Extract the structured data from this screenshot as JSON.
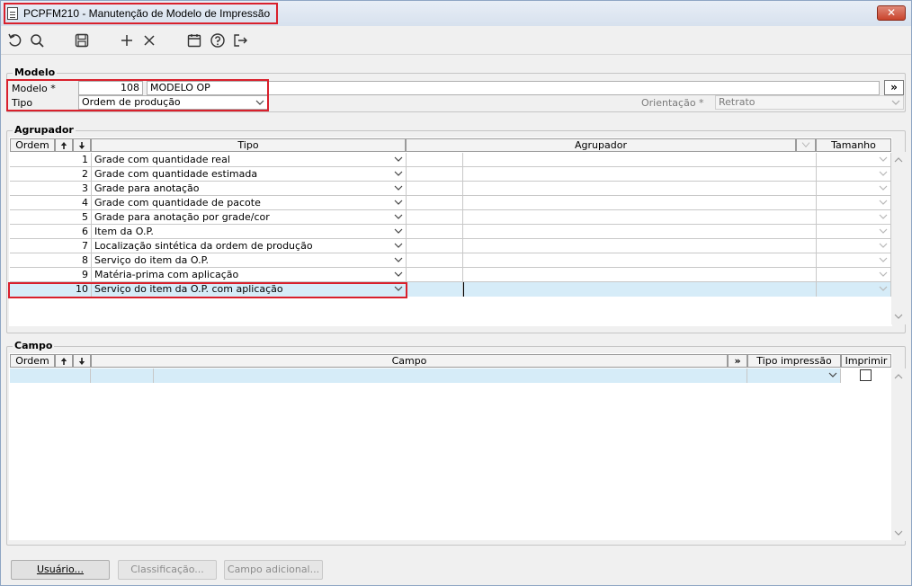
{
  "window": {
    "title": "PCPFM210 - Manutenção de Modelo de Impressão"
  },
  "toolbar": {
    "icons": [
      "undo-icon",
      "search-icon",
      "save-icon",
      "add-icon",
      "delete-icon",
      "calendar-icon",
      "help-icon",
      "exit-icon"
    ]
  },
  "modelo": {
    "group_label": "Modelo",
    "modelo_label": "Modelo *",
    "modelo_code": "108",
    "modelo_name": "MODELO OP",
    "tipo_label": "Tipo",
    "tipo_value": "Ordem de produção",
    "orientacao_label": "Orientação *",
    "orientacao_value": "Retrato",
    "expand_label": "»"
  },
  "agrupador": {
    "group_label": "Agrupador",
    "headers": {
      "ordem": "Ordem",
      "tipo": "Tipo",
      "agrupador": "Agrupador",
      "tamanho": "Tamanho"
    },
    "rows": [
      {
        "ordem": "1",
        "tipo": "Grade com quantidade real"
      },
      {
        "ordem": "2",
        "tipo": "Grade com quantidade estimada"
      },
      {
        "ordem": "3",
        "tipo": "Grade para anotação"
      },
      {
        "ordem": "4",
        "tipo": "Grade com quantidade de pacote"
      },
      {
        "ordem": "5",
        "tipo": "Grade para anotação por grade/cor"
      },
      {
        "ordem": "6",
        "tipo": "Item da O.P."
      },
      {
        "ordem": "7",
        "tipo": "Localização sintética da ordem de produção"
      },
      {
        "ordem": "8",
        "tipo": "Serviço do item da O.P."
      },
      {
        "ordem": "9",
        "tipo": "Matéria-prima com aplicação"
      },
      {
        "ordem": "10",
        "tipo": "Serviço do item da O.P. com aplicação"
      }
    ]
  },
  "campo": {
    "group_label": "Campo",
    "headers": {
      "ordem": "Ordem",
      "campo": "Campo",
      "expand": "»",
      "tipo_impressao": "Tipo impressão",
      "imprimir": "Imprimir"
    }
  },
  "buttons": {
    "usuario": "Usuário...",
    "classificacao": "Classificação...",
    "campo_adicional": "Campo adicional..."
  },
  "colors": {
    "highlight": "#d9202c",
    "selected_row": "#d6ecf8"
  }
}
